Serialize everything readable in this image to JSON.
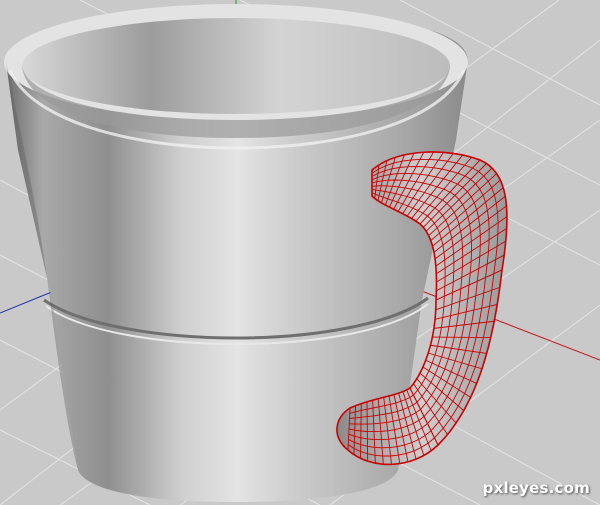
{
  "watermark": "pxleyes.com",
  "viewport": {
    "background_color": "#c9c9c9",
    "grid_color": "#e4e4e4",
    "axis_colors": {
      "x": "#c41a1a",
      "y": "#1fa21f",
      "z": "#2233aa"
    }
  },
  "model": {
    "body": "mug-body",
    "handle": "mug-handle",
    "handle_wireframe_color": "#cc0000"
  }
}
